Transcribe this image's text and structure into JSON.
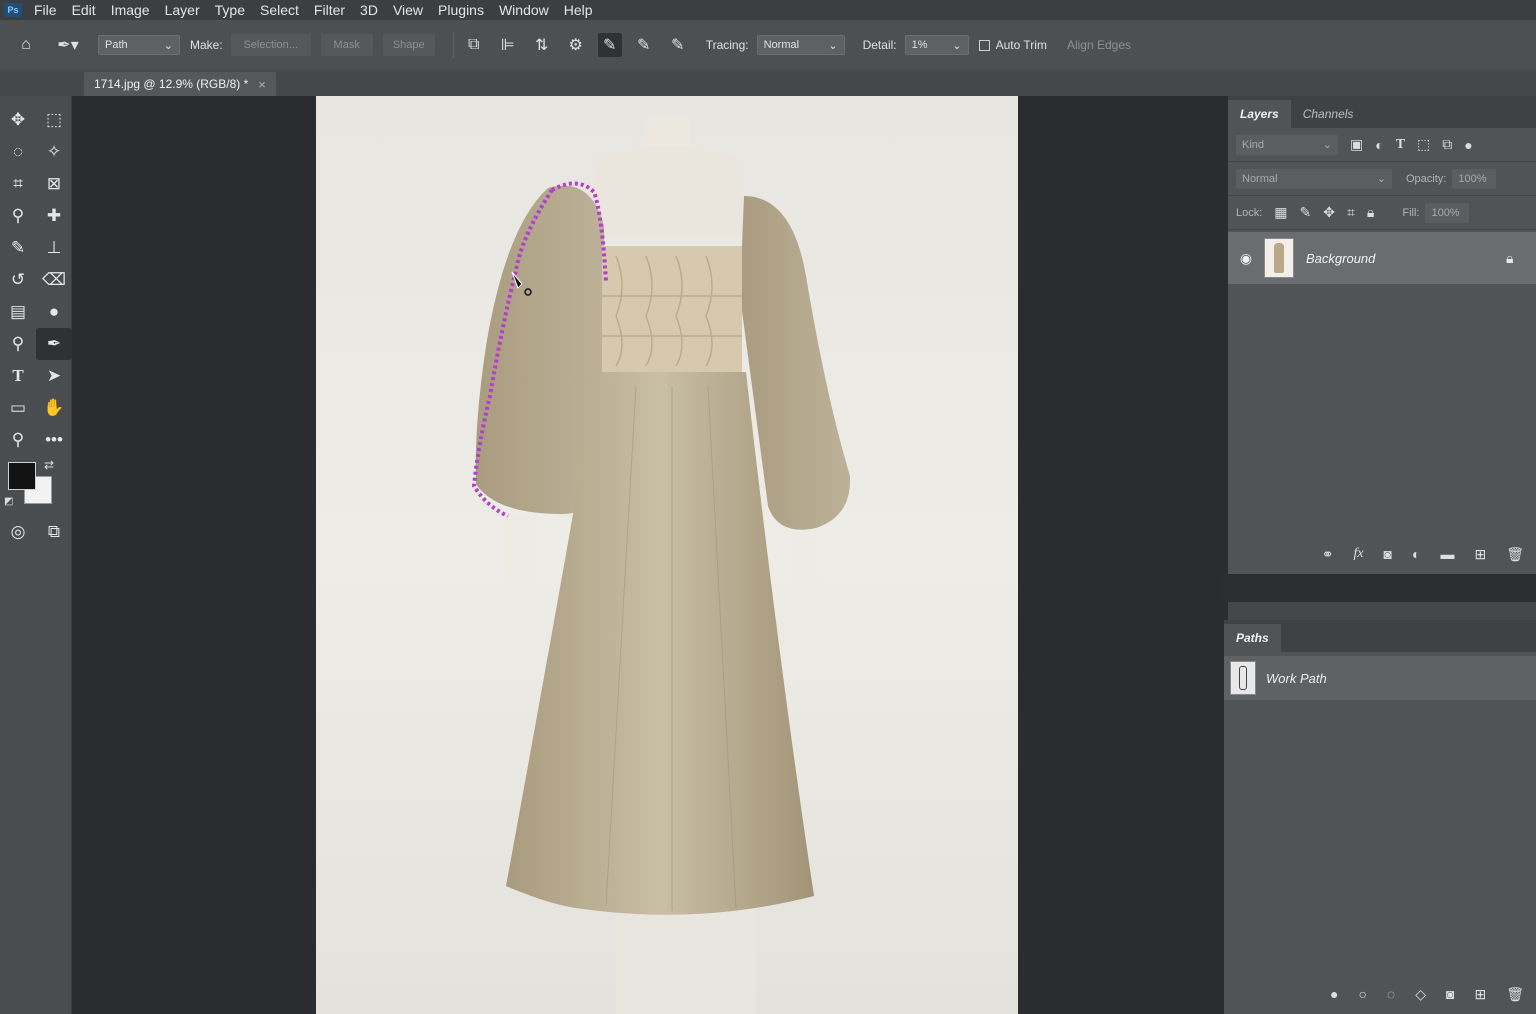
{
  "menu": [
    "File",
    "Edit",
    "Image",
    "Layer",
    "Type",
    "Select",
    "Filter",
    "3D",
    "View",
    "Plugins",
    "Window",
    "Help"
  ],
  "options": {
    "mode_value": "Path",
    "make_label": "Make:",
    "selection_btn": "Selection...",
    "mask_btn": "Mask",
    "shape_btn": "Shape",
    "tracing_label": "Tracing:",
    "tracing_value": "Normal",
    "detail_label": "Detail:",
    "detail_value": "1%",
    "auto_trim_label": "Auto Trim",
    "align_edges_label": "Align Edges"
  },
  "document": {
    "tab_title": "1714.jpg @ 12.9% (RGB/8) *",
    "close_glyph": "×"
  },
  "layers_panel": {
    "tabs": [
      "Layers",
      "Channels"
    ],
    "kind_placeholder": "Kind",
    "blend_mode": "Normal",
    "opacity_label": "Opacity:",
    "opacity_value": "100%",
    "lock_label": "Lock:",
    "fill_label": "Fill:",
    "fill_value": "100%",
    "layer_name": "Background"
  },
  "paths_panel": {
    "tab": "Paths",
    "path_name": "Work Path"
  },
  "colors": {
    "path_stroke": "#b43fc9",
    "dress": "#b8ab8e"
  }
}
